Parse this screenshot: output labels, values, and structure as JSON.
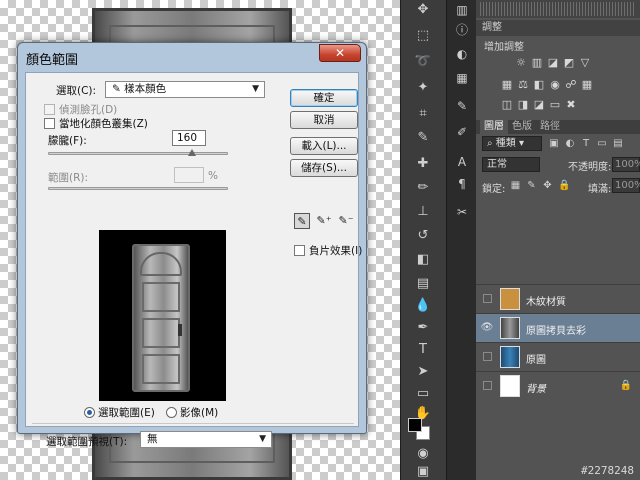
{
  "dialog": {
    "title": "顏色範圍",
    "close_label": "✕",
    "select_label": "選取(C):",
    "select_value": "樣本顏色",
    "detect_faces_label": "偵測臉孔(D)",
    "localized_label": "當地化顏色叢集(Z)",
    "fuzziness_label": "朦朧(F):",
    "fuzziness_value": "160",
    "fuzziness_fraction": 0.8,
    "range_label": "範圍(R):",
    "range_value": "",
    "range_unit": "%",
    "selection_radio_label": "選取範圍(E)",
    "image_radio_label": "影像(M)",
    "preview_label": "選取範圍預視(T):",
    "preview_value": "無",
    "ok_button": "確定",
    "cancel_button": "取消",
    "load_button": "載入(L)...",
    "save_button": "儲存(S)...",
    "invert_label": "負片效果(I)"
  },
  "panels": {
    "adjustments_tab": "調整",
    "adjustments_subtitle": "增加調整",
    "tabs": [
      "圖層",
      "色版",
      "路徑"
    ],
    "kind_label": "種類",
    "blend_mode": "正常",
    "opacity_label": "不透明度:",
    "opacity_value": "100%",
    "lock_label": "鎖定:",
    "fill_label": "填滿:",
    "fill_value": "100%",
    "layers": [
      {
        "name": "木紋材質",
        "visible": false,
        "selected": false,
        "thumb_color": "#c9913f"
      },
      {
        "name": "原圖拷貝去彩",
        "visible": true,
        "selected": true,
        "thumb_color": "#7a7a7a"
      },
      {
        "name": "原圖",
        "visible": false,
        "selected": false,
        "thumb_color": "#2c6a9c"
      },
      {
        "name": "背景",
        "visible": false,
        "selected": false,
        "thumb_color": "#ffffff"
      }
    ]
  },
  "watermark": "#2278248"
}
